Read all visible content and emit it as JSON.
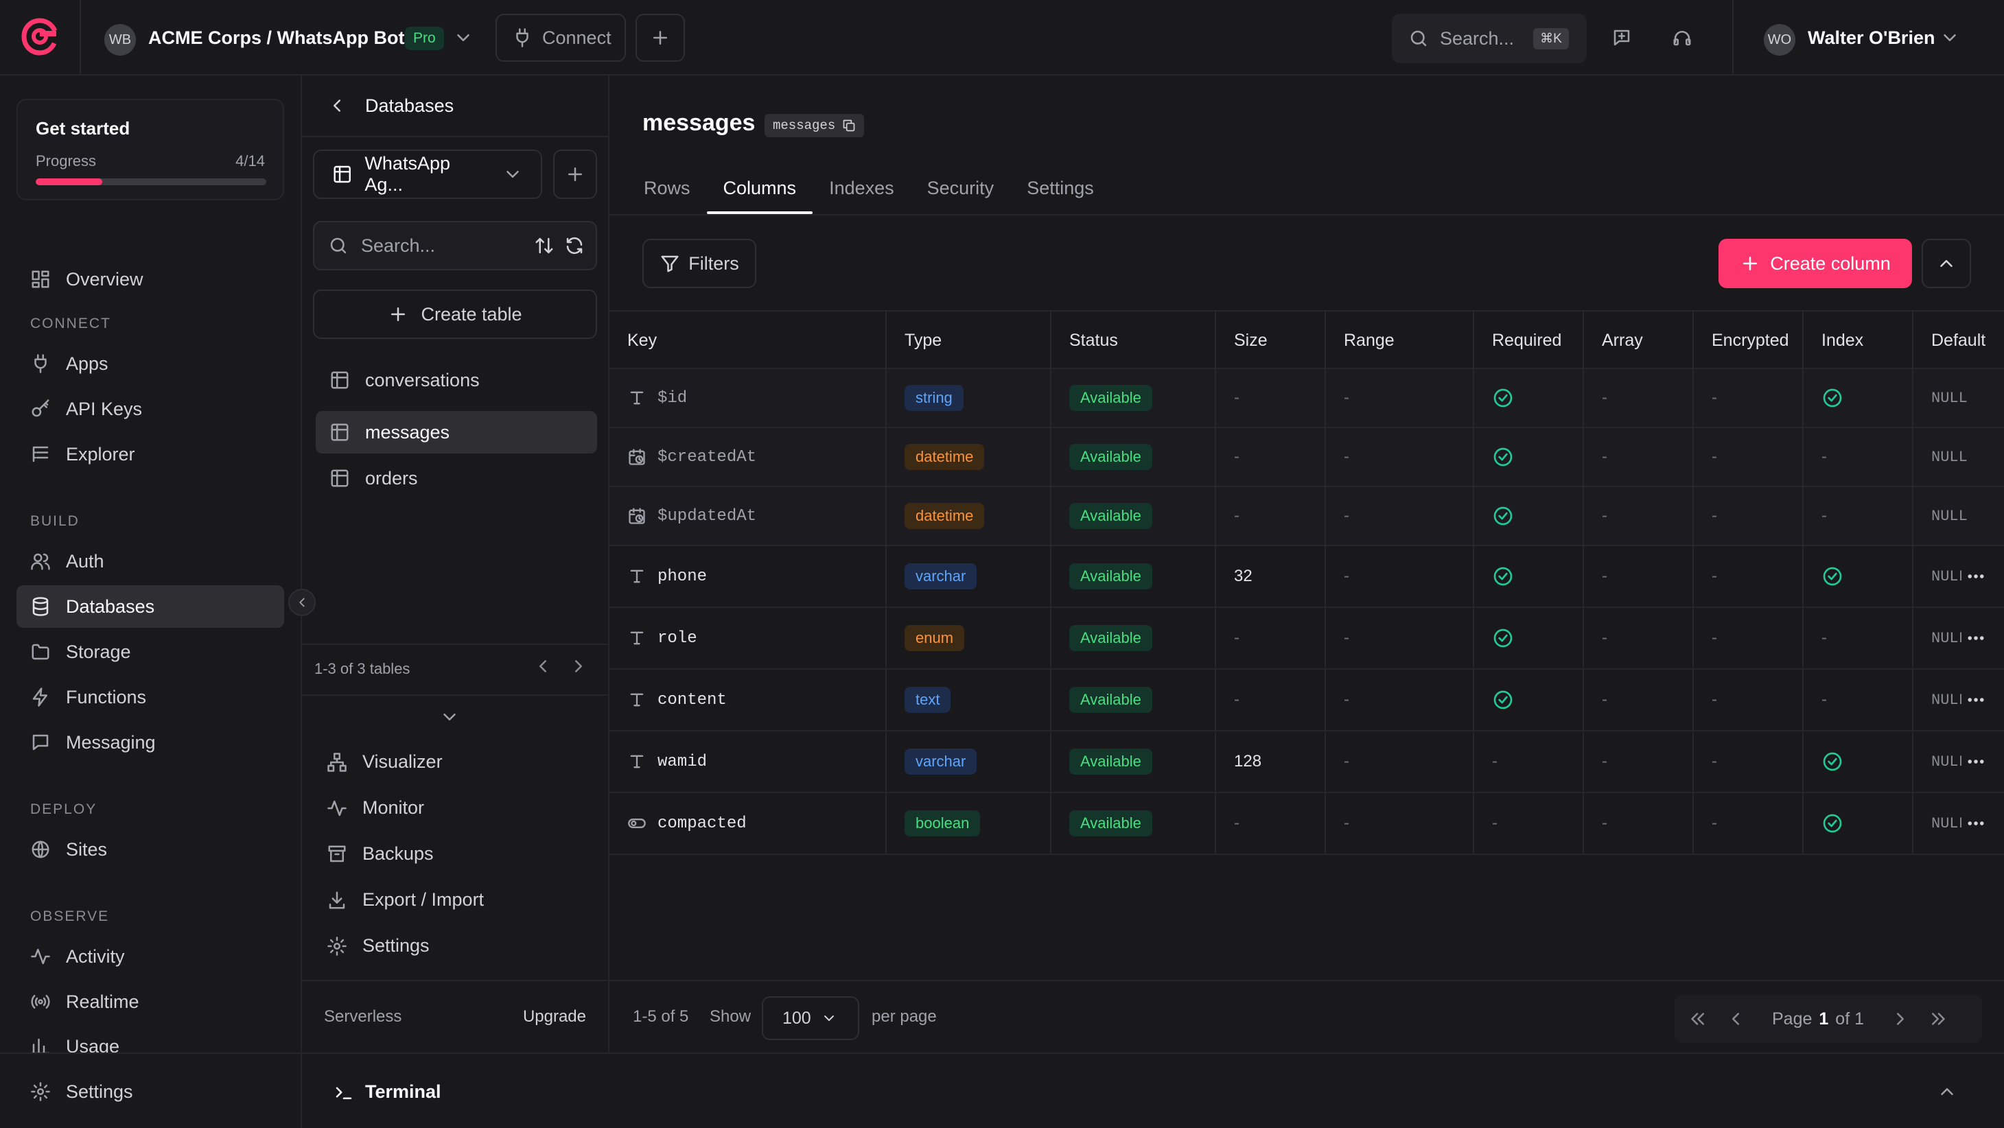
{
  "header": {
    "org_initials": "WB",
    "org_name": "ACME Corps / WhatsApp Bot",
    "plan_badge": "Pro",
    "connect_label": "Connect",
    "search_placeholder": "Search...",
    "search_shortcut": "⌘K",
    "user_initials": "WO",
    "user_name": "Walter O'Brien"
  },
  "get_started": {
    "title": "Get started",
    "progress_label": "Progress",
    "progress_text": "4/14",
    "progress_fraction": 0.29
  },
  "sidebar": {
    "overview": "Overview",
    "sections": {
      "connect": "CONNECT",
      "build": "BUILD",
      "deploy": "DEPLOY",
      "observe": "OBSERVE"
    },
    "connect_items": [
      "Apps",
      "API Keys",
      "Explorer"
    ],
    "build_items": [
      "Auth",
      "Databases",
      "Storage",
      "Functions",
      "Messaging"
    ],
    "deploy_items": [
      "Sites"
    ],
    "observe_items": [
      "Activity",
      "Realtime",
      "Usage"
    ],
    "settings": "Settings"
  },
  "subnav": {
    "back_label": "Databases",
    "database_name": "WhatsApp Ag...",
    "search_placeholder": "Search...",
    "create_table": "Create table",
    "tables": [
      "conversations",
      "messages",
      "orders"
    ],
    "tables_count": "1-3 of 3 tables",
    "tools": [
      "Visualizer",
      "Monitor",
      "Backups",
      "Export / Import",
      "Settings"
    ],
    "plan": "Serverless",
    "upgrade": "Upgrade"
  },
  "main": {
    "title": "messages",
    "id_chip": "messages",
    "tabs": [
      "Rows",
      "Columns",
      "Indexes",
      "Security",
      "Settings"
    ],
    "filters_label": "Filters",
    "create_column_label": "Create column"
  },
  "table": {
    "headers": [
      "Key",
      "Type",
      "Status",
      "Size",
      "Range",
      "Required",
      "Array",
      "Encrypted",
      "Index",
      "Default"
    ],
    "rows": [
      {
        "key": "$id",
        "icon": "text-icon",
        "type": "string",
        "status": "Available",
        "size": "-",
        "range": "-",
        "required": true,
        "array": "-",
        "encrypted": "-",
        "index": true,
        "default": "NULL",
        "system": true
      },
      {
        "key": "$createdAt",
        "icon": "calendar-clock-icon",
        "type": "datetime",
        "status": "Available",
        "size": "-",
        "range": "-",
        "required": true,
        "array": "-",
        "encrypted": "-",
        "index": false,
        "default": "NULL",
        "system": true
      },
      {
        "key": "$updatedAt",
        "icon": "calendar-clock-icon",
        "type": "datetime",
        "status": "Available",
        "size": "-",
        "range": "-",
        "required": true,
        "array": "-",
        "encrypted": "-",
        "index": false,
        "default": "NULL",
        "system": true
      },
      {
        "key": "phone",
        "icon": "text-icon",
        "type": "varchar",
        "status": "Available",
        "size": "32",
        "range": "-",
        "required": true,
        "array": "-",
        "encrypted": "-",
        "index": true,
        "default": "NULL",
        "system": false
      },
      {
        "key": "role",
        "icon": "text-icon",
        "type": "enum",
        "status": "Available",
        "size": "-",
        "range": "-",
        "required": true,
        "array": "-",
        "encrypted": "-",
        "index": false,
        "default": "NULL",
        "system": false
      },
      {
        "key": "content",
        "icon": "text-icon",
        "type": "text",
        "status": "Available",
        "size": "-",
        "range": "-",
        "required": true,
        "array": "-",
        "encrypted": "-",
        "index": false,
        "default": "NULL",
        "system": false
      },
      {
        "key": "wamid",
        "icon": "text-icon",
        "type": "varchar",
        "status": "Available",
        "size": "128",
        "range": "-",
        "required": false,
        "array": "-",
        "encrypted": "-",
        "index": true,
        "default": "NULL",
        "system": false
      },
      {
        "key": "compacted",
        "icon": "toggle-icon",
        "type": "boolean",
        "status": "Available",
        "size": "-",
        "range": "-",
        "required": false,
        "array": "-",
        "encrypted": "-",
        "index": true,
        "default": "NULL",
        "system": false
      }
    ]
  },
  "type_colors": {
    "string": {
      "bg": "#1c2c4a",
      "fg": "#60a5fa"
    },
    "varchar": {
      "bg": "#1c2c4a",
      "fg": "#60a5fa"
    },
    "text": {
      "bg": "#1c2c4a",
      "fg": "#60a5fa"
    },
    "datetime": {
      "bg": "#3d2a14",
      "fg": "#fb923c"
    },
    "enum": {
      "bg": "#3d2a14",
      "fg": "#fb923c"
    },
    "boolean": {
      "bg": "#14352a",
      "fg": "#4ade80"
    }
  },
  "footer": {
    "count": "1-5 of 5",
    "show_label": "Show",
    "per_page_value": "100",
    "per_page_label": "per page",
    "page_label": "Page",
    "page_current": "1",
    "page_of": "of 1"
  },
  "terminal": {
    "label": "Terminal"
  }
}
